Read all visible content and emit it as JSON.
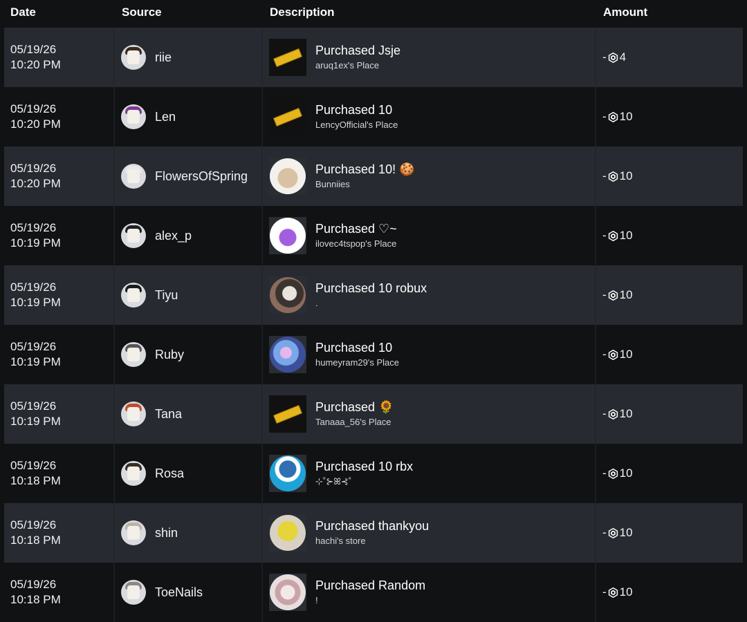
{
  "headers": {
    "date": "Date",
    "source": "Source",
    "description": "Description",
    "amount": "Amount"
  },
  "colors": {
    "background": "#111214",
    "row_alt": "#272a30",
    "ticket": "#e6b51c"
  },
  "rows": [
    {
      "date": "05/19/26",
      "time": "10:20 PM",
      "user": "riie",
      "title": "Purchased Jsje",
      "place": "aruq1ex's Place",
      "sign": "-",
      "amount": "4",
      "thumb": "ticket",
      "hair": "#3b2a1d"
    },
    {
      "date": "05/19/26",
      "time": "10:20 PM",
      "user": "Len",
      "title": "Purchased 10",
      "place": "LencyOfficial's Place",
      "sign": "-",
      "amount": "10",
      "thumb": "ticket",
      "hair": "#7a3d8f"
    },
    {
      "date": "05/19/26",
      "time": "10:20 PM",
      "user": "FlowersOfSpring",
      "title": "Purchased 10! 🍪",
      "place": "Bunniies",
      "sign": "-",
      "amount": "10",
      "thumb": "latte",
      "hair": "#e9e9e9"
    },
    {
      "date": "05/19/26",
      "time": "10:19 PM",
      "user": "alex_p",
      "title": "Purchased ♡~",
      "place": "ilovec4tspop's Place",
      "sign": "-",
      "amount": "10",
      "thumb": "cat",
      "hair": "#202020"
    },
    {
      "date": "05/19/26",
      "time": "10:19 PM",
      "user": "Tiyu",
      "title": "Purchased 10 robux",
      "place": ".",
      "sign": "-",
      "amount": "10",
      "thumb": "bunny",
      "hair": "#1c1c1c"
    },
    {
      "date": "05/19/26",
      "time": "10:19 PM",
      "user": "Ruby",
      "title": "Purchased 10",
      "place": "humeyram29's Place",
      "sign": "-",
      "amount": "10",
      "thumb": "galaxy",
      "hair": "#555555"
    },
    {
      "date": "05/19/26",
      "time": "10:19 PM",
      "user": "Tana",
      "title": "Purchased 🌻",
      "place": "Tanaaa_56's Place",
      "sign": "-",
      "amount": "10",
      "thumb": "ticket",
      "hair": "#c24a2e"
    },
    {
      "date": "05/19/26",
      "time": "10:18 PM",
      "user": "Rosa",
      "title": "Purchased 10 rbx",
      "place": "⊹˚⊱ꕤ⊰˚",
      "sign": "-",
      "amount": "10",
      "thumb": "noob",
      "hair": "#3a2c26"
    },
    {
      "date": "05/19/26",
      "time": "10:18 PM",
      "user": "shin",
      "title": "Purchased thankyou",
      "place": "hachi's store",
      "sign": "-",
      "amount": "10",
      "thumb": "glasses",
      "hair": "#b9b2aa"
    },
    {
      "date": "05/19/26",
      "time": "10:18 PM",
      "user": "ToeNails",
      "title": "Purchased Random",
      "place": "!",
      "sign": "-",
      "amount": "10",
      "thumb": "cake",
      "hair": "#8c8782"
    }
  ]
}
